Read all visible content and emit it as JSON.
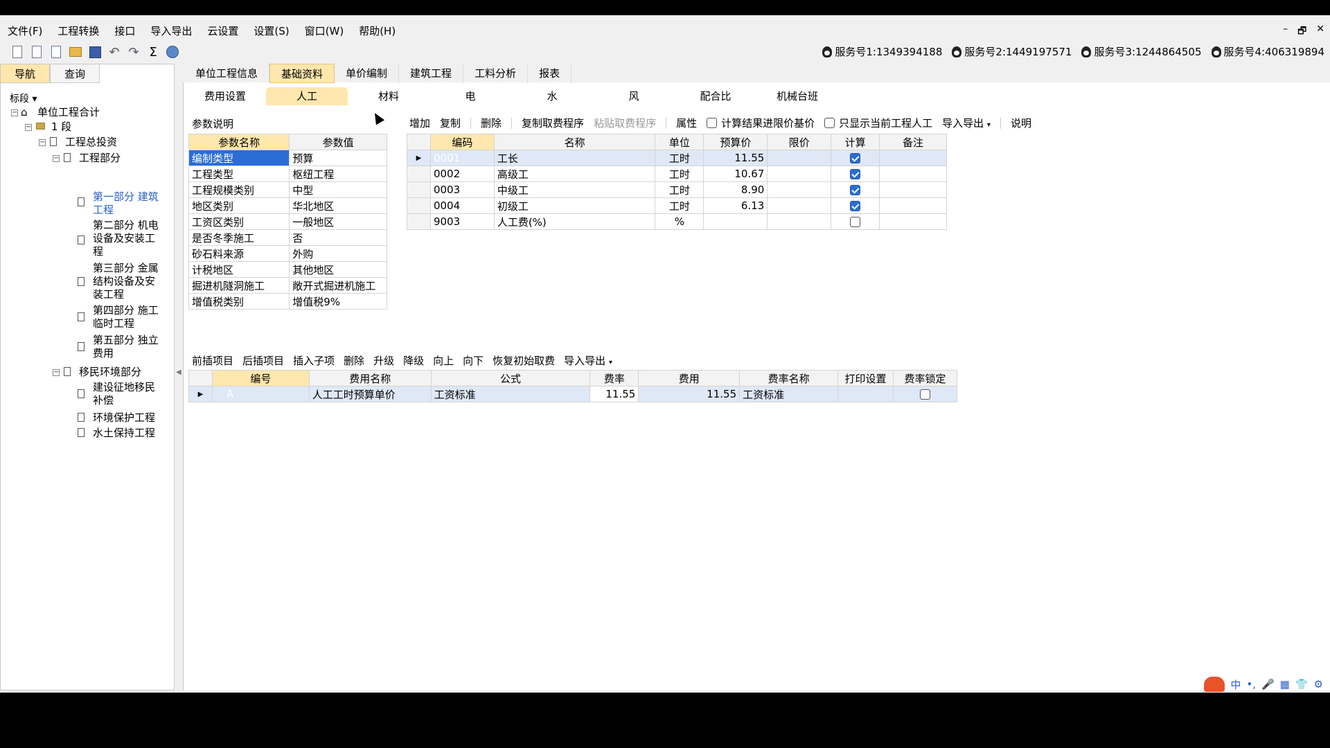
{
  "menu": [
    "文件(F)",
    "工程转换",
    "接口",
    "导入导出",
    "云设置",
    "设置(S)",
    "窗口(W)",
    "帮助(H)"
  ],
  "window_controls": [
    "–",
    "🗗",
    "✕"
  ],
  "services": [
    "服务号1:1349394188",
    "服务号2:1449197571",
    "服务号3:1244864505",
    "服务号4:406319894"
  ],
  "left_tabs": [
    "导航",
    "查询"
  ],
  "left_dropdown": "标段",
  "tree": {
    "root": "单位工程合计",
    "seg": "1 段",
    "total": "工程总投资",
    "eng": "工程部分",
    "p1": "第一部分 建筑工程",
    "p2": "第二部分 机电设备及安装工程",
    "p3": "第三部分 金属结构设备及安装工程",
    "p4": "第四部分 施工临时工程",
    "p5": "第五部分 独立费用",
    "migr": "移民环境部分",
    "m1": "建设征地移民补偿",
    "m2": "环境保护工程",
    "m3": "水土保持工程"
  },
  "top_tabs": [
    "单位工程信息",
    "基础资料",
    "单价编制",
    "建筑工程",
    "工料分析",
    "报表"
  ],
  "active_top_tab": 1,
  "sub_tabs": [
    "费用设置",
    "人工",
    "材料",
    "电",
    "水",
    "风",
    "配合比",
    "机械台班"
  ],
  "active_sub_tab": 1,
  "param_section_label": "参数说明",
  "param_headers": [
    "参数名称",
    "参数值"
  ],
  "params": [
    [
      "编制类型",
      "预算"
    ],
    [
      "工程类型",
      "枢纽工程"
    ],
    [
      "工程规模类别",
      "中型"
    ],
    [
      "地区类别",
      "华北地区"
    ],
    [
      "工资区类别",
      "一般地区"
    ],
    [
      "是否冬季施工",
      "否"
    ],
    [
      "砂石料来源",
      "外购"
    ],
    [
      "计税地区",
      "其他地区"
    ],
    [
      "掘进机隧洞施工",
      "敞开式掘进机施工"
    ],
    [
      "增值税类别",
      "增值税9%"
    ]
  ],
  "labor_toolbar": {
    "add": "增加",
    "copy": "复制",
    "delete": "删除",
    "copy_proc": "复制取费程序",
    "paste_proc": "粘贴取费程序",
    "attr": "属性",
    "chk1": "计算结果进限价基价",
    "chk2": "只显示当前工程人工",
    "import": "导入导出",
    "help": "说明"
  },
  "labor_headers": [
    "编码",
    "名称",
    "单位",
    "预算价",
    "限价",
    "计算",
    "备注"
  ],
  "labor_rows": [
    {
      "code": "0001",
      "name": "工长",
      "unit": "工时",
      "price": "11.55",
      "limit": "",
      "calc": true,
      "note": ""
    },
    {
      "code": "0002",
      "name": "高级工",
      "unit": "工时",
      "price": "10.67",
      "limit": "",
      "calc": true,
      "note": ""
    },
    {
      "code": "0003",
      "name": "中级工",
      "unit": "工时",
      "price": "8.90",
      "limit": "",
      "calc": true,
      "note": ""
    },
    {
      "code": "0004",
      "name": "初级工",
      "unit": "工时",
      "price": "6.13",
      "limit": "",
      "calc": true,
      "note": ""
    },
    {
      "code": "9003",
      "name": "人工费(%)",
      "unit": "%",
      "price": "",
      "limit": "",
      "calc": false,
      "note": ""
    }
  ],
  "fee_toolbar": [
    "前插项目",
    "后插项目",
    "插入子项",
    "删除",
    "升级",
    "降级",
    "向上",
    "向下",
    "恢复初始取费",
    "导入导出"
  ],
  "fee_headers": [
    "编号",
    "费用名称",
    "公式",
    "费率",
    "费用",
    "费率名称",
    "打印设置",
    "费率锁定"
  ],
  "fee_rows": [
    {
      "no": "A",
      "name": "人工工时预算单价",
      "formula": "工资标准",
      "rate": "11.55",
      "fee": "11.55",
      "rate_name": "工资标准",
      "print": "",
      "lock": false
    }
  ],
  "tray": [
    "中",
    "•,",
    "🎤",
    "▦",
    "👕",
    "⚙"
  ]
}
